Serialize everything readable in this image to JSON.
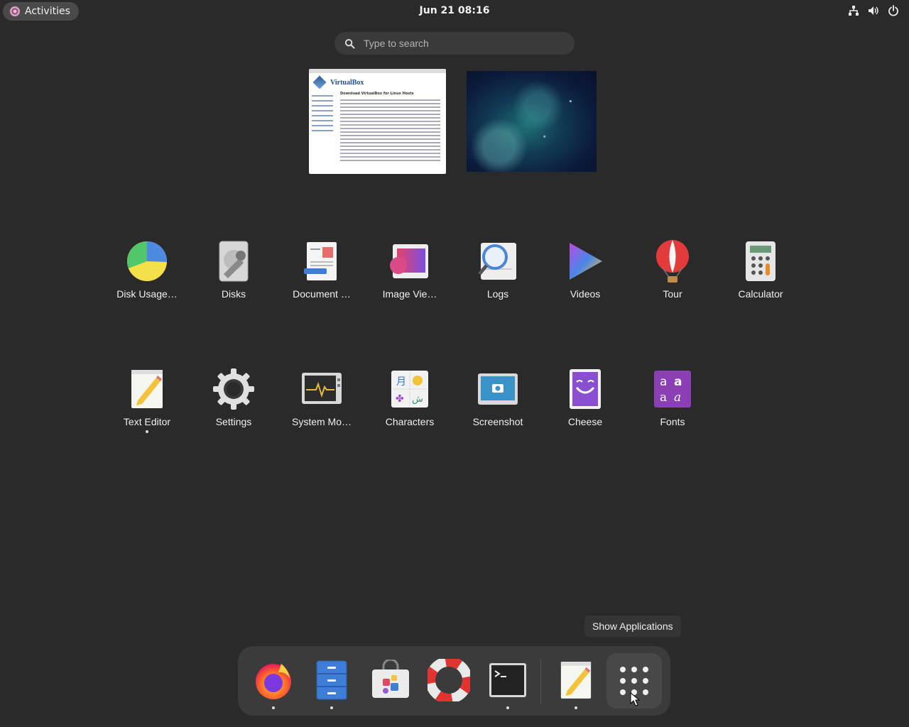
{
  "topbar": {
    "activities_label": "Activities",
    "clock": "Jun 21  08:16",
    "tray_icons": [
      "network-wired-icon",
      "volume-icon",
      "power-icon"
    ]
  },
  "search": {
    "placeholder": "Type to search"
  },
  "workspaces": [
    {
      "title": "VirtualBox",
      "subtitle": "Download VirtualBox for Linux Hosts"
    },
    {
      "title": ""
    }
  ],
  "apps": [
    {
      "label": "Disk Usage…",
      "icon": "disk-usage-icon"
    },
    {
      "label": "Disks",
      "icon": "disks-icon"
    },
    {
      "label": "Document …",
      "icon": "document-viewer-icon"
    },
    {
      "label": "Image Vie…",
      "icon": "image-viewer-icon"
    },
    {
      "label": "Logs",
      "icon": "logs-icon"
    },
    {
      "label": "Videos",
      "icon": "videos-icon"
    },
    {
      "label": "Tour",
      "icon": "tour-balloon-icon"
    },
    {
      "label": "Calculator",
      "icon": "calculator-icon"
    },
    {
      "label": "Text Editor",
      "icon": "text-editor-icon",
      "running": true
    },
    {
      "label": "Settings",
      "icon": "settings-gear-icon"
    },
    {
      "label": "System Mo…",
      "icon": "system-monitor-icon"
    },
    {
      "label": "Characters",
      "icon": "characters-icon"
    },
    {
      "label": "Screenshot",
      "icon": "screenshot-icon"
    },
    {
      "label": "Cheese",
      "icon": "cheese-icon"
    },
    {
      "label": "Fonts",
      "icon": "fonts-icon"
    }
  ],
  "tooltip": {
    "text": "Show Applications"
  },
  "dock": {
    "items": [
      {
        "name": "firefox",
        "icon": "firefox-icon",
        "running": true
      },
      {
        "name": "files",
        "icon": "files-icon",
        "running": true
      },
      {
        "name": "software",
        "icon": "software-bag-icon",
        "running": false
      },
      {
        "name": "help",
        "icon": "help-lifebuoy-icon",
        "running": false
      },
      {
        "name": "terminal",
        "icon": "terminal-icon",
        "running": true
      },
      {
        "name": "text-editor",
        "icon": "text-editor-icon",
        "running": true
      }
    ],
    "show_apps_icon": "app-grid-icon"
  }
}
